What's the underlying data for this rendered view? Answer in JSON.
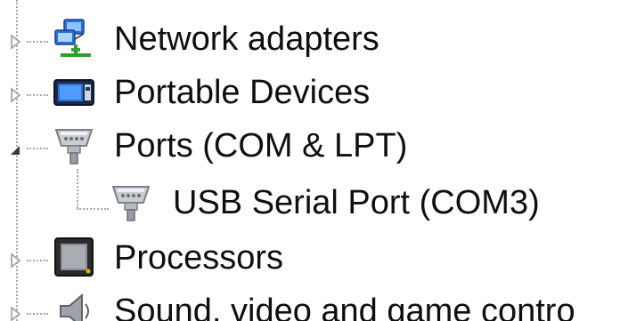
{
  "device_tree": {
    "items": [
      {
        "label": "Network adapters",
        "icon": "network-adapter-icon",
        "state": "collapsed"
      },
      {
        "label": "Portable Devices",
        "icon": "portable-device-icon",
        "state": "collapsed"
      },
      {
        "label": "Ports (COM & LPT)",
        "icon": "port-connector-icon",
        "state": "expanded",
        "children": [
          {
            "label": "USB Serial Port (COM3)",
            "icon": "port-connector-icon"
          }
        ]
      },
      {
        "label": "Processors",
        "icon": "processor-icon",
        "state": "collapsed"
      },
      {
        "label": "Sound, video and game contro",
        "icon": "speaker-icon",
        "state": "collapsed"
      }
    ]
  }
}
